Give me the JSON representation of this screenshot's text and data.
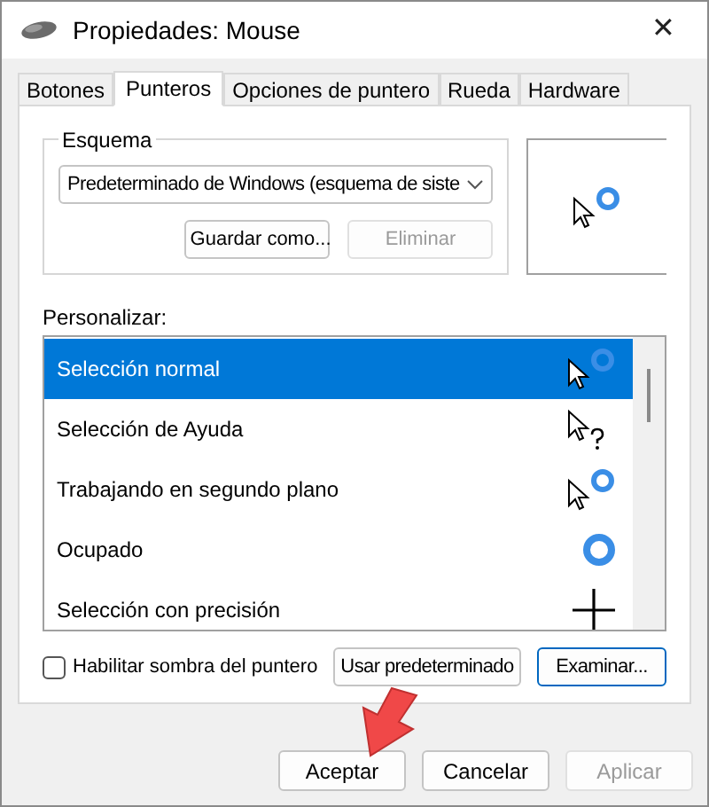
{
  "window": {
    "title": "Propiedades: Mouse",
    "close": "✕"
  },
  "tabs": [
    {
      "label": "Botones",
      "selected": false
    },
    {
      "label": "Punteros",
      "selected": true
    },
    {
      "label": "Opciones de puntero",
      "selected": false
    },
    {
      "label": "Rueda",
      "selected": false
    },
    {
      "label": "Hardware",
      "selected": false
    }
  ],
  "scheme": {
    "label": "Esquema",
    "value": "Predeterminado de Windows (esquema de siste",
    "buttons": [
      {
        "label": "Guardar como...",
        "disabled": false
      },
      {
        "label": "Eliminar",
        "disabled": true
      }
    ]
  },
  "customize": {
    "label": "Personalizar:",
    "rows": [
      {
        "label": "Selección normal",
        "kind": "arrow-busy",
        "selected": true
      },
      {
        "label": "Selección de Ayuda",
        "kind": "help",
        "selected": false
      },
      {
        "label": "Trabajando en segundo plano",
        "kind": "arrow-busy",
        "selected": false
      },
      {
        "label": "Ocupado",
        "kind": "busy",
        "selected": false
      },
      {
        "label": "Selección con precisión",
        "kind": "cross",
        "selected": false
      }
    ]
  },
  "shadow": {
    "label": "Habilitar sombra del puntero",
    "checked": false
  },
  "pointer_buttons": [
    {
      "label": "Usar predeterminado",
      "focused": false
    },
    {
      "label": "Examinar...",
      "focused": true
    }
  ],
  "footer_buttons": [
    {
      "label": "Aceptar",
      "disabled": false
    },
    {
      "label": "Cancelar",
      "disabled": false
    },
    {
      "label": "Aplicar",
      "disabled": true
    }
  ]
}
